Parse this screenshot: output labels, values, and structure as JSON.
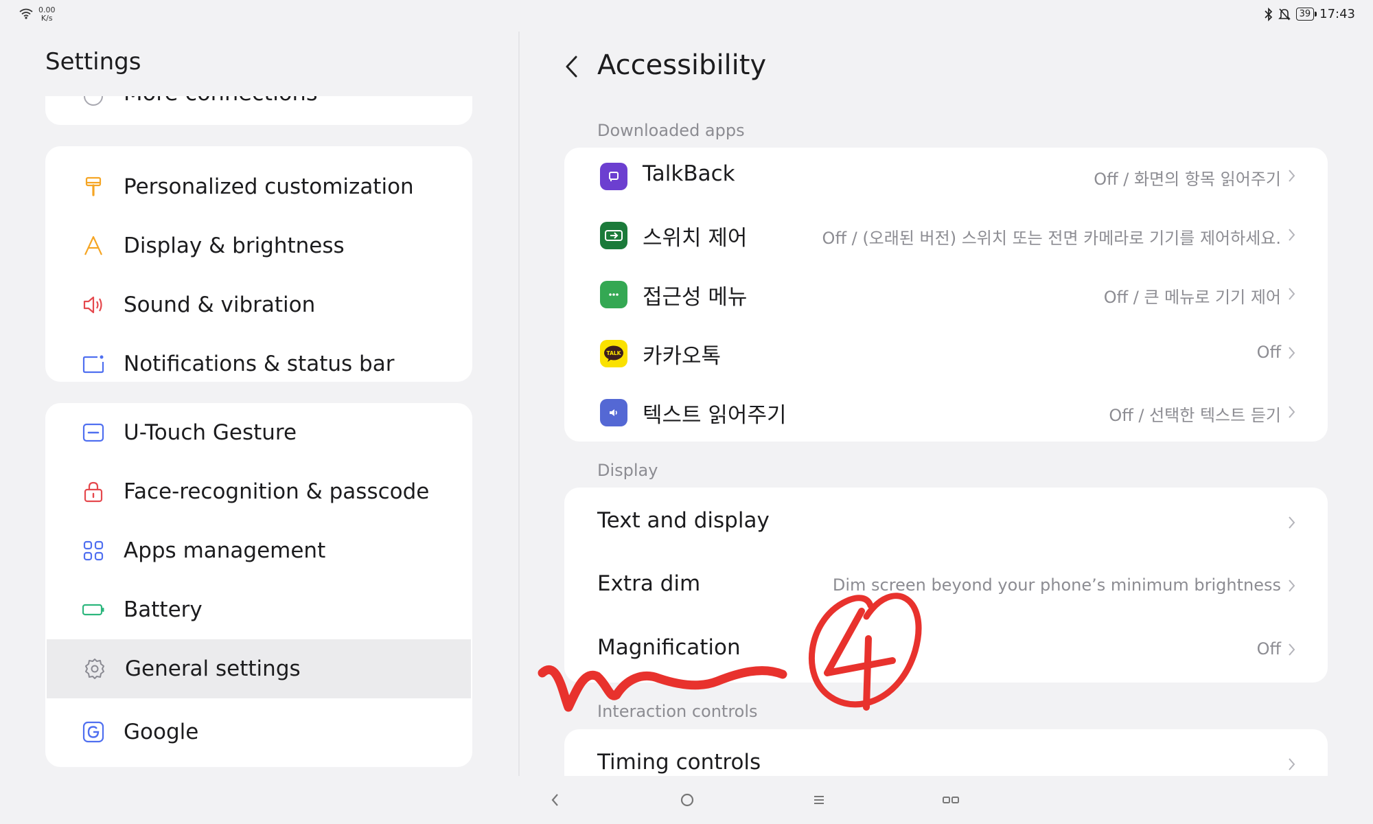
{
  "status_bar": {
    "net_speed_value": "0.00",
    "net_speed_unit": "K/s",
    "battery": "39",
    "time": "17:43"
  },
  "left_pane": {
    "title": "Settings",
    "partial_item": "More connections",
    "group_a": [
      {
        "label": "Personalized customization",
        "icon": "paint-brush-icon"
      },
      {
        "label": "Display & brightness",
        "icon": "letter-a-icon"
      },
      {
        "label": "Sound & vibration",
        "icon": "speaker-icon"
      },
      {
        "label": "Notifications & status bar",
        "icon": "notification-icon"
      }
    ],
    "group_b": [
      {
        "label": "U-Touch Gesture",
        "icon": "gesture-icon"
      },
      {
        "label": "Face-recognition & passcode",
        "icon": "lock-icon"
      },
      {
        "label": "Apps management",
        "icon": "apps-grid-icon"
      },
      {
        "label": "Battery",
        "icon": "battery-icon"
      },
      {
        "label": "General settings",
        "icon": "gear-icon",
        "selected": true
      },
      {
        "label": "Google",
        "icon": "google-icon"
      }
    ]
  },
  "right_pane": {
    "title": "Accessibility",
    "sections": {
      "downloaded_apps": {
        "header": "Downloaded apps",
        "items": [
          {
            "label": "TalkBack",
            "value": "Off / 화면의 항목 읽어주기",
            "icon": "talkback-icon"
          },
          {
            "label": "스위치 제어",
            "value": "Off / (오래된 버전) 스위치 또는 전면 카메라로 기기를 제어하세요.",
            "icon": "switch-control-icon"
          },
          {
            "label": "접근성 메뉴",
            "value": "Off / 큰 메뉴로 기기 제어",
            "icon": "accessibility-menu-icon"
          },
          {
            "label": "카카오톡",
            "value": "Off",
            "icon": "kakaotalk-icon",
            "icon_text": "TALK"
          },
          {
            "label": "텍스트 읽어주기",
            "value": "Off / 선택한 텍스트 듣기",
            "icon": "select-to-speak-icon"
          }
        ]
      },
      "display": {
        "header": "Display",
        "items": [
          {
            "label": "Text and display",
            "value": ""
          },
          {
            "label": "Extra dim",
            "value": "Dim screen beyond your phone’s minimum brightness"
          },
          {
            "label": "Magnification",
            "value": "Off"
          }
        ]
      },
      "interaction": {
        "header": "Interaction controls",
        "items": [
          {
            "label": "Timing controls",
            "value": ""
          }
        ]
      }
    }
  },
  "annotation": {
    "text": "4",
    "color": "#e8322d"
  },
  "colors": {
    "background": "#f2f2f4",
    "card": "#ffffff",
    "selected": "#ebebed",
    "secondary_text": "#8c8c92",
    "icon_orange": "#f5a524",
    "icon_red": "#e5484d",
    "icon_blue": "#4f6ff0",
    "icon_green": "#2cb67d"
  }
}
